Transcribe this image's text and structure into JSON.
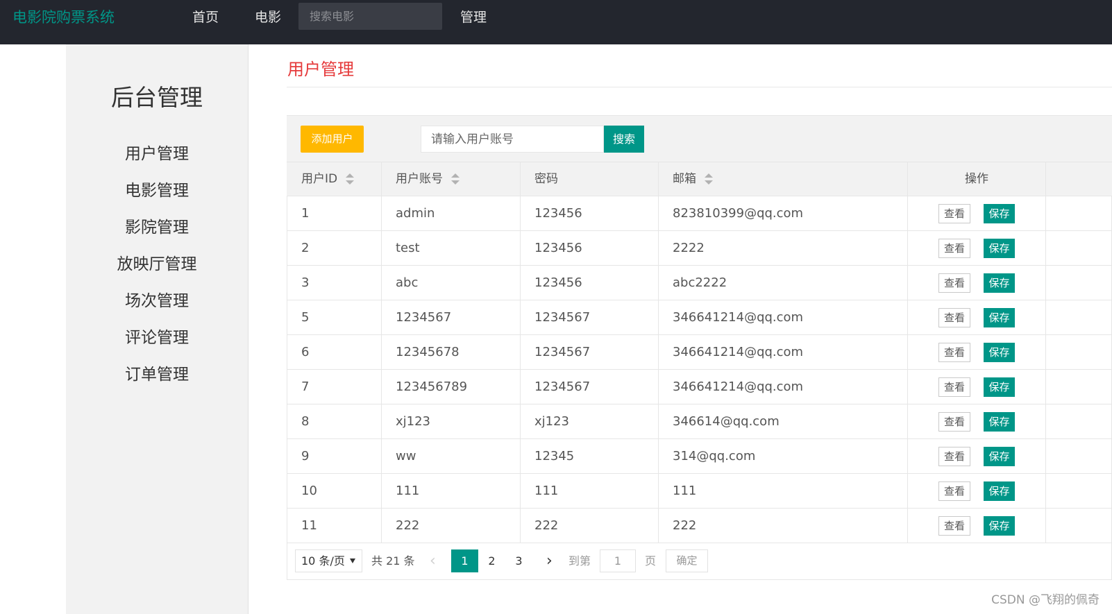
{
  "navbar": {
    "brand": "电影院购票系统",
    "items": [
      "首页",
      "电影",
      "管理"
    ],
    "search_placeholder": "搜索电影"
  },
  "sidebar": {
    "title": "后台管理",
    "items": [
      "用户管理",
      "电影管理",
      "影院管理",
      "放映厅管理",
      "场次管理",
      "评论管理",
      "订单管理"
    ]
  },
  "main": {
    "title": "用户管理",
    "add_button": "添加用户",
    "search_placeholder": "请输入用户账号",
    "search_button": "搜索"
  },
  "table": {
    "headers": [
      "用户ID",
      "用户账号",
      "密码",
      "邮箱",
      "操作"
    ],
    "view_label": "查看",
    "save_label": "保存",
    "rows": [
      [
        "1",
        "admin",
        "123456",
        "823810399@qq.com"
      ],
      [
        "2",
        "test",
        "123456",
        "2222"
      ],
      [
        "3",
        "abc",
        "123456",
        "abc2222"
      ],
      [
        "5",
        "1234567",
        "1234567",
        "346641214@qq.com"
      ],
      [
        "6",
        "12345678",
        "1234567",
        "346641214@qq.com"
      ],
      [
        "7",
        "123456789",
        "1234567",
        "346641214@qq.com"
      ],
      [
        "8",
        "xj123",
        "xj123",
        "346614@qq.com"
      ],
      [
        "9",
        "ww",
        "12345",
        "314@qq.com"
      ],
      [
        "10",
        "111",
        "111",
        "111"
      ],
      [
        "11",
        "222",
        "222",
        "222"
      ]
    ]
  },
  "pagination": {
    "page_size": "10 条/页",
    "total": "共 21 条",
    "pages": [
      "1",
      "2",
      "3"
    ],
    "current_page": "1",
    "goto_label": "到第",
    "goto_value": "1",
    "page_suffix": "页",
    "confirm": "确定"
  },
  "watermark": "CSDN @飞翔的佩奇",
  "colors": {
    "navbar_bg": "#23262e",
    "brand": "#009688",
    "primary": "#009688",
    "warm": "#ffb800",
    "title_red": "#e5393a"
  }
}
